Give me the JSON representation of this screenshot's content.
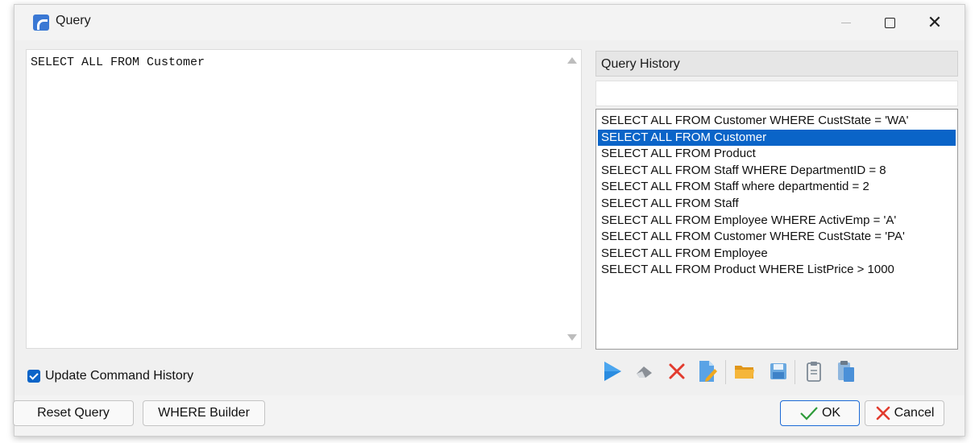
{
  "window": {
    "title": "Query"
  },
  "editor": {
    "text": "SELECT ALL FROM Customer"
  },
  "history": {
    "header": "Query History",
    "filter_value": "",
    "items": [
      "SELECT ALL FROM Customer WHERE CustState = 'WA'",
      "SELECT ALL FROM Customer",
      "SELECT ALL FROM Product",
      "SELECT ALL FROM  Staff WHERE DepartmentID = 8",
      "SELECT ALL FROM Staff where departmentid = 2",
      "SELECT ALL FROM Staff",
      "SELECT ALL FROM Employee WHERE ActivEmp = 'A'",
      "SELECT ALL FROM Customer WHERE CustState = 'PA'",
      "SELECT ALL FROM Employee",
      "SELECT ALL FROM Product WHERE ListPrice > 1000"
    ],
    "selected_index": 1
  },
  "options": {
    "update_history_label": "Update Command History",
    "update_history_checked": true
  },
  "toolbar": {
    "icons": [
      "play-icon",
      "eraser-icon",
      "delete-icon",
      "edit-document-icon",
      "folder-open-icon",
      "save-icon",
      "clipboard-icon",
      "paste-icon"
    ]
  },
  "buttons": {
    "reset": "Reset Query",
    "where": "WHERE Builder",
    "ok": "OK",
    "cancel": "Cancel"
  },
  "colors": {
    "accent": "#0a64c8",
    "play": "#2a8ce0",
    "delete": "#e23b2e",
    "folder": "#f0a81e"
  }
}
